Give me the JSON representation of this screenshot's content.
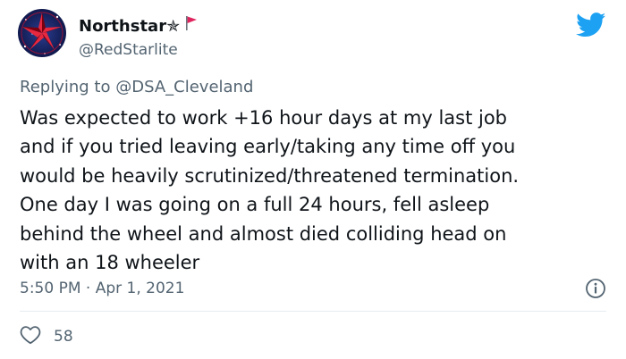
{
  "author": {
    "display_name": "Northstar✯",
    "handle": "@RedStarlite",
    "avatar_icon": "red-nautical-star-icon",
    "name_flag_icon": "red-flag-icon"
  },
  "brand_icon": "twitter-bird-icon",
  "reply": {
    "prefix": "Replying to",
    "mention": "@DSA_Cleveland"
  },
  "text_lines": [
    "Was expected to work +16 hour days at my last job",
    "and if you tried leaving early/taking any time off you",
    "would be heavily scrutinized/threatened termination.",
    "One day I was going on a full 24 hours, fell asleep",
    "behind the wheel and almost died colliding head on",
    "with an 18 wheeler"
  ],
  "timestamp": "5:50 PM · Apr 1, 2021",
  "like_count": "58",
  "colors": {
    "text": "#0f1419",
    "muted": "#536471",
    "brand": "#1da1f2",
    "star_red": "#c8102e",
    "flag_red": "#e0245e"
  }
}
